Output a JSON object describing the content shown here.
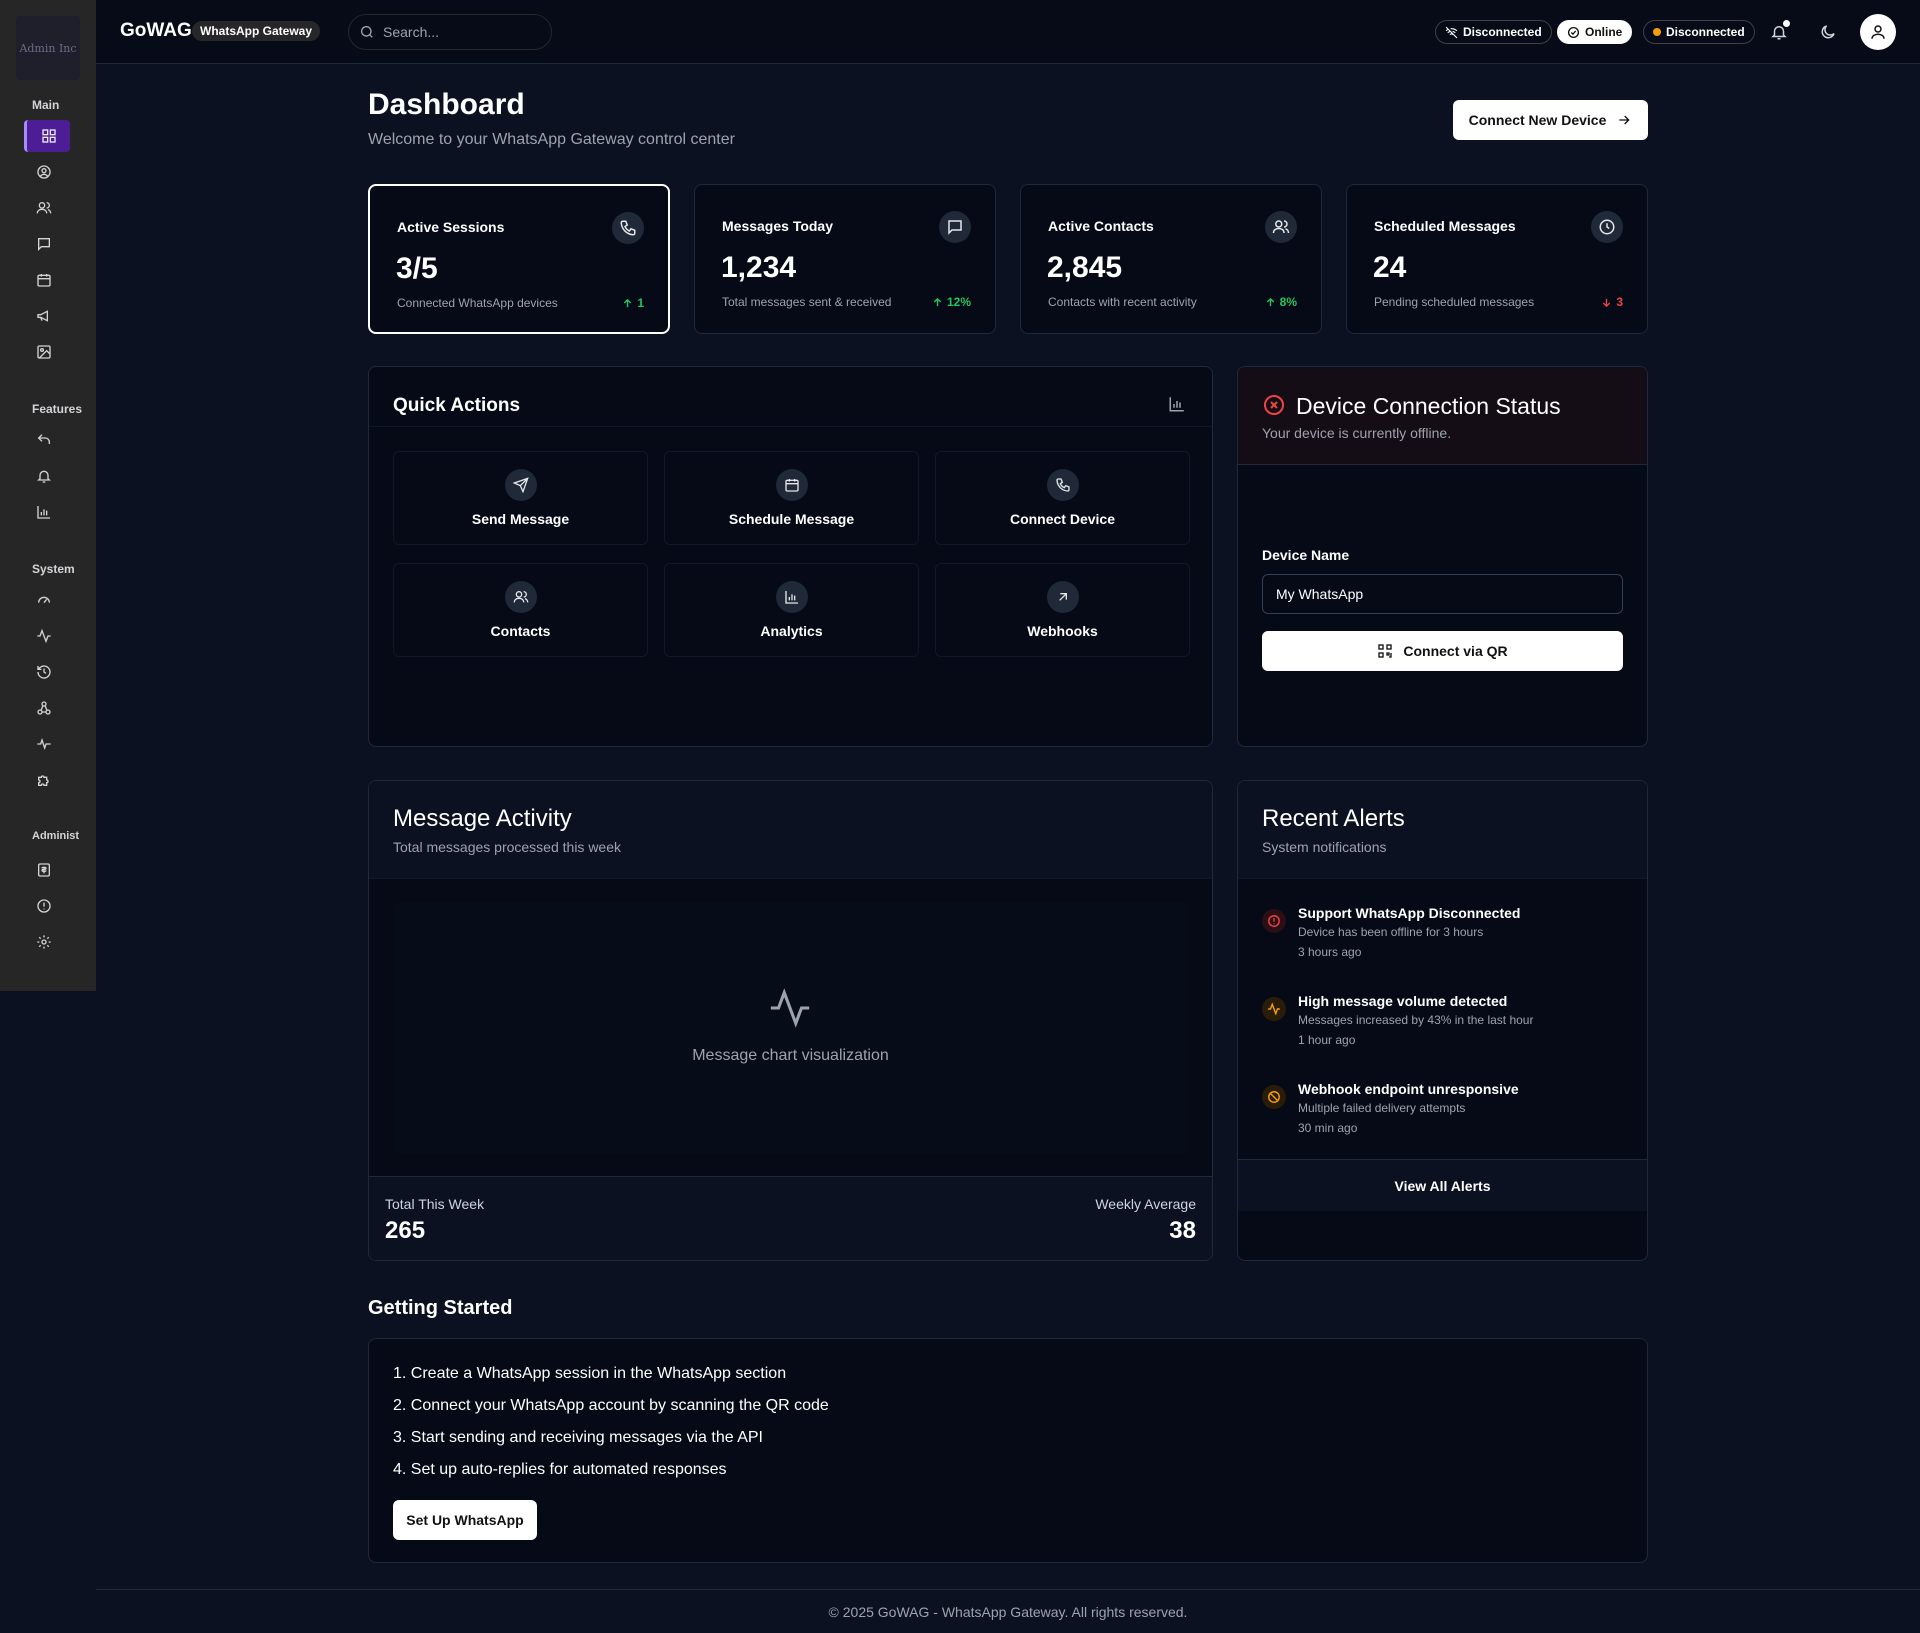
{
  "sidebar": {
    "logo_text": "Admin Inc",
    "sections": [
      "Main",
      "Features",
      "System",
      "Administ"
    ]
  },
  "topbar": {
    "brand": "GoWAG",
    "badge": "WhatsApp Gateway",
    "search_placeholder": "Search...",
    "status_pills": [
      "Disconnected",
      "Online",
      "Disconnected"
    ]
  },
  "header": {
    "title": "Dashboard",
    "subtitle": "Welcome to your WhatsApp Gateway control center",
    "connect_button": "Connect New Device"
  },
  "stats": [
    {
      "title": "Active Sessions",
      "value": "3/5",
      "desc": "Connected WhatsApp devices",
      "trend": "1",
      "direction": "up",
      "icon": "phone-icon"
    },
    {
      "title": "Messages Today",
      "value": "1,234",
      "desc": "Total messages sent & received",
      "trend": "12%",
      "direction": "up",
      "icon": "message-icon"
    },
    {
      "title": "Active Contacts",
      "value": "2,845",
      "desc": "Contacts with recent activity",
      "trend": "8%",
      "direction": "up",
      "icon": "users-icon"
    },
    {
      "title": "Scheduled Messages",
      "value": "24",
      "desc": "Pending scheduled messages",
      "trend": "3",
      "direction": "down",
      "icon": "clock-icon"
    }
  ],
  "quick_actions": {
    "title": "Quick Actions",
    "items": [
      {
        "label": "Send Message",
        "icon": "send-icon"
      },
      {
        "label": "Schedule Message",
        "icon": "calendar-icon"
      },
      {
        "label": "Connect Device",
        "icon": "phone-icon"
      },
      {
        "label": "Contacts",
        "icon": "users-icon"
      },
      {
        "label": "Analytics",
        "icon": "bar-chart-icon"
      },
      {
        "label": "Webhooks",
        "icon": "arrow-up-right-icon"
      }
    ]
  },
  "device_status": {
    "title": "Device Connection Status",
    "subtitle": "Your device is currently offline.",
    "field_label": "Device Name",
    "field_value": "My WhatsApp",
    "button": "Connect via QR"
  },
  "activity": {
    "title": "Message Activity",
    "subtitle": "Total messages processed this week",
    "placeholder": "Message chart visualization",
    "total_label": "Total This Week",
    "total_value": "265",
    "avg_label": "Weekly Average",
    "avg_value": "38"
  },
  "alerts": {
    "title": "Recent Alerts",
    "subtitle": "System notifications",
    "items": [
      {
        "title": "Support WhatsApp Disconnected",
        "desc": "Device has been offline for 3 hours",
        "time": "3 hours ago",
        "color": "#ef4444"
      },
      {
        "title": "High message volume detected",
        "desc": "Messages increased by 43% in the last hour",
        "time": "1 hour ago",
        "color": "#f59e0b"
      },
      {
        "title": "Webhook endpoint unresponsive",
        "desc": "Multiple failed delivery attempts",
        "time": "30 min ago",
        "color": "#f59e0b"
      }
    ],
    "view_all": "View All Alerts"
  },
  "getting_started": {
    "title": "Getting Started",
    "steps": [
      "1. Create a WhatsApp session in the WhatsApp section",
      "2. Connect your WhatsApp account by scanning the QR code",
      "3. Start sending and receiving messages via the API",
      "4. Set up auto-replies for automated responses"
    ],
    "button": "Set Up WhatsApp"
  },
  "footer": "© 2025 GoWAG - WhatsApp Gateway. All rights reserved.",
  "colors": {
    "accent": "#4c1d95",
    "success": "#22c55e",
    "danger": "#ef4444",
    "warning": "#f59e0b",
    "background": "#0b1120"
  }
}
